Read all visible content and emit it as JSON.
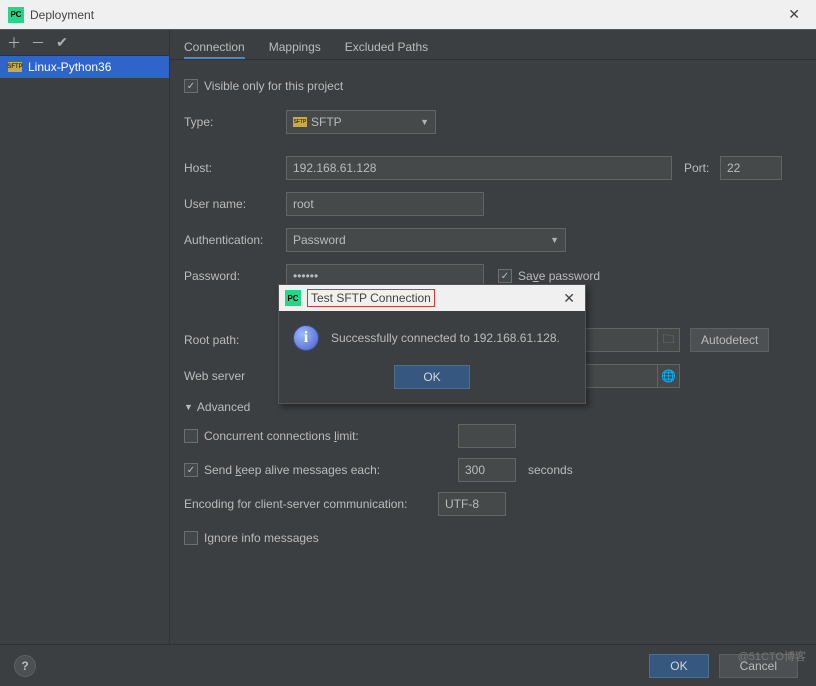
{
  "window": {
    "title": "Deployment"
  },
  "sidebar": {
    "items": [
      {
        "label": "Linux-Python36"
      }
    ]
  },
  "tabs": {
    "connection": "Connection",
    "mappings": "Mappings",
    "excluded": "Excluded Paths"
  },
  "form": {
    "visible_only": "Visible only for this project",
    "type_label": "Type:",
    "type_value": "SFTP",
    "host_label": "Host:",
    "host_value": "192.168.61.128",
    "port_label": "Port:",
    "port_value": "22",
    "user_label": "User name:",
    "user_value": "root",
    "auth_label": "Authentication:",
    "auth_value": "Password",
    "pw_label": "Password:",
    "pw_value": "••••••",
    "save_pw": "Save password",
    "save_pw_u": "v",
    "root_label": "Root path:",
    "web_label": "Web server",
    "autodetect": "Autodetect",
    "advanced": "Advanced",
    "concurrent": "Concurrent connections limit:",
    "concurrent_u": "l",
    "keepalive_pre": "Send ",
    "keepalive_u": "k",
    "keepalive_post": "eep alive messages each:",
    "keepalive_value": "300",
    "seconds": "seconds",
    "encoding_label": "Encoding for client-server communication:",
    "encoding_value": "UTF-8",
    "ignore": "Ignore info messages"
  },
  "modal": {
    "title": "Test SFTP Connection",
    "message": "Successfully connected to 192.168.61.128.",
    "ok": "OK"
  },
  "footer": {
    "ok": "OK",
    "cancel": "Cancel",
    "watermark": "@51CTO博客"
  }
}
